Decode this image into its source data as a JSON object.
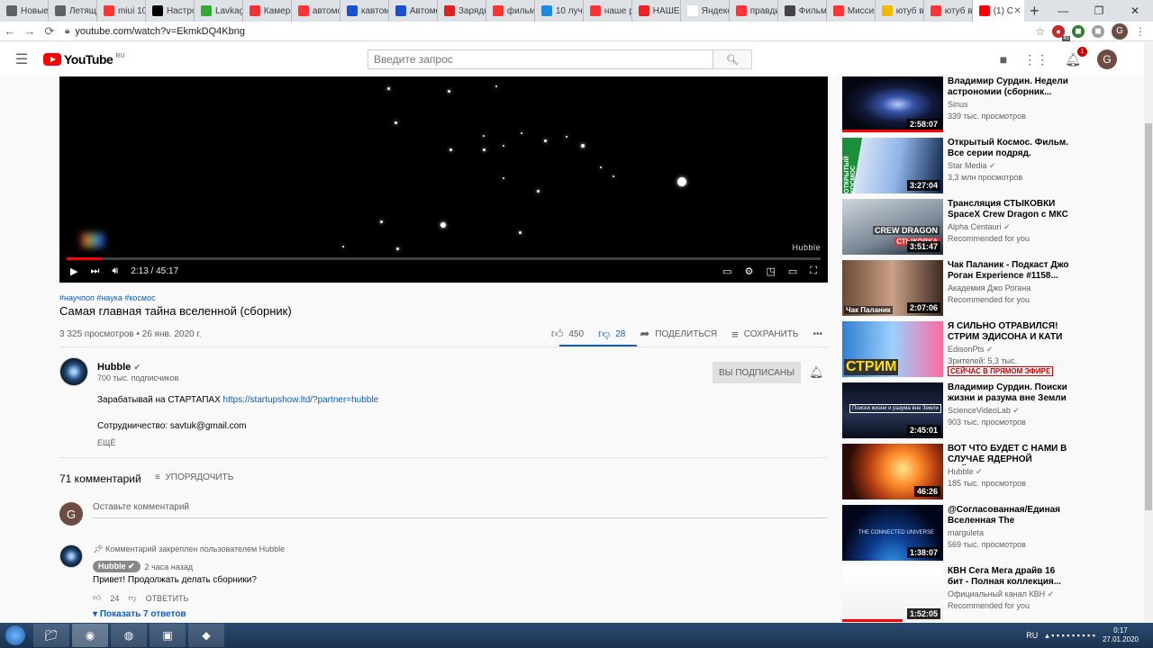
{
  "browser": {
    "tabs": [
      {
        "title": "Новые",
        "icon": "globe-icon",
        "color": "#5f6368"
      },
      {
        "title": "Летящ",
        "icon": "globe-icon",
        "color": "#5f6368"
      },
      {
        "title": "miui 10",
        "icon": "yandex-icon",
        "color": "#f33"
      },
      {
        "title": "Настро",
        "icon": "t2-icon",
        "color": "#000"
      },
      {
        "title": "Lavkag",
        "icon": "leaf-icon",
        "color": "#3a3"
      },
      {
        "title": "Камера",
        "icon": "l-icon",
        "color": "#e33"
      },
      {
        "title": "автомо",
        "icon": "yandex-icon",
        "color": "#f33"
      },
      {
        "title": "кавтом",
        "icon": "cart-icon",
        "color": "#1a4fd0"
      },
      {
        "title": "Автомо",
        "icon": "cart-icon",
        "color": "#1a4fd0"
      },
      {
        "title": "Зарядн",
        "icon": "circle-icon",
        "color": "#d22"
      },
      {
        "title": "фильм",
        "icon": "yandex-icon",
        "color": "#f33"
      },
      {
        "title": "10 лучш",
        "icon": "f-icon",
        "color": "#1e88e5"
      },
      {
        "title": "наше р",
        "icon": "yandex-icon",
        "color": "#f33"
      },
      {
        "title": "НАШЕ",
        "icon": "n-icon",
        "color": "#e22"
      },
      {
        "title": "Яндекс",
        "icon": "blank-icon",
        "color": "#fff"
      },
      {
        "title": "правди",
        "icon": "yandex-icon",
        "color": "#f33"
      },
      {
        "title": "Фильм",
        "icon": "heart-icon",
        "color": "#444"
      },
      {
        "title": "Миссия",
        "icon": "yandex-icon",
        "color": "#f33"
      },
      {
        "title": "ютуб в",
        "icon": "play-icon",
        "color": "#f5b800"
      },
      {
        "title": "ютуб в",
        "icon": "yandex-icon",
        "color": "#f33"
      },
      {
        "title": "(1) С",
        "icon": "youtube-icon",
        "color": "#f00"
      }
    ],
    "url": "youtube.com/watch?v=EkmkDQ4Kbng",
    "ext_badge": "45"
  },
  "header": {
    "logo_text": "YouTube",
    "logo_region": "RU",
    "search_placeholder": "Введите запрос",
    "notif_count": "1",
    "avatar_letter": "G"
  },
  "player": {
    "watermark": "Hubble",
    "time": "2:13 / 45:17",
    "progress_fraction": 0.047
  },
  "video": {
    "hashtags": "#научпоп #наука #космос",
    "title": "Самая главная тайна вселенной (сборник)",
    "views_date": "3 325 просмотров • 26 янв. 2020 г.",
    "likes": "450",
    "dislikes": "28",
    "share": "ПОДЕЛИТЬСЯ",
    "save": "СОХРАНИТЬ",
    "more": "•••"
  },
  "owner": {
    "name": "Hubble",
    "subscribers": "700 тыс. подписчиков",
    "subscribed_label": "ВЫ ПОДПИСАНЫ"
  },
  "description": {
    "line1_text": "Зарабатывай на СТАРТАПАХ",
    "line1_link": "https://startupshow.ltd/?partner=hubble",
    "line2": "Сотрудничество: savtuk@gmail.com",
    "more": "ЕЩЁ"
  },
  "comments": {
    "count": "71 комментарий",
    "sort_label": "УПОРЯДОЧИТЬ",
    "placeholder": "Оставьте комментарий",
    "user_letter": "G",
    "pinned_label": "Комментарий закреплен пользователем Hubble",
    "top": {
      "author": "Hubble",
      "time": "2 часа назад",
      "text": "Привет! Продолжать делать сборники?",
      "likes": "24",
      "reply": "ОТВЕТИТЬ",
      "show_replies": "Показать 7 ответов"
    }
  },
  "related": [
    {
      "title": "Владимир Сурдин. Недели астрономии (сборник...",
      "channel": "Sinus",
      "views": "339 тыс. просмотров",
      "duration": "2:58:07",
      "verified": false,
      "live": "",
      "watched": 1.0
    },
    {
      "title": "Открытый Космос. Фильм. Все серии подряд. StarMedia",
      "channel": "Star Media",
      "views": "3,3 млн просмотров",
      "duration": "3:27:04",
      "verified": true,
      "live": "",
      "watched": 0
    },
    {
      "title": "Трансляция СТЫКОВКИ SpaceX Crew Dragon с МКС",
      "channel": "Alpha Centauri",
      "views": "Recommended for you",
      "duration": "3:51:47",
      "verified": true,
      "live": "",
      "watched": 0
    },
    {
      "title": "Чак Паланик - Подкаст Джо Роган Experience #1158...",
      "channel": "Академия Джо Рогана",
      "views": "Recommended for you",
      "duration": "2:07:06",
      "verified": false,
      "live": "",
      "watched": 0
    },
    {
      "title": "Я СИЛЬНО ОТРАВИЛСЯ! СТРИМ ЭДИСОНА И КАТИ",
      "channel": "EdisonPts",
      "views": "Зрителей: 5,3 тыс.",
      "duration": "",
      "verified": true,
      "live": "СЕЙЧАС В ПРЯМОМ ЭФИРЕ",
      "watched": 0
    },
    {
      "title": "Владимир Сурдин. Поиски жизни и разума вне Земли",
      "channel": "ScienceVideoLab",
      "views": "903 тыс. просмотров",
      "duration": "2:45:01",
      "verified": true,
      "live": "",
      "watched": 0
    },
    {
      "title": "ВОТ ЧТО БУДЕТ С НАМИ В СЛУЧАЕ ЯДЕРНОЙ ВОЙНЫ...",
      "channel": "Hubble",
      "views": "185 тыс. просмотров",
      "duration": "46:26",
      "verified": true,
      "live": "",
      "watched": 0
    },
    {
      "title": "@Согласованная/Единая Вселенная The Connected...",
      "channel": "marguleta",
      "views": "569 тыс. просмотров",
      "duration": "1:38:07",
      "verified": false,
      "live": "",
      "watched": 0
    },
    {
      "title": "КВН Сега Мега драйв 16 бит - Полная коллекция...",
      "channel": "Официальный канал КВН",
      "views": "Recommended for you",
      "duration": "1:52:05",
      "verified": true,
      "live": "",
      "watched": 0.6
    }
  ],
  "thumb_text": {
    "crew": "CREW DRAGON",
    "dock": "СТЫКОВКА",
    "stream": "СТРИМ",
    "open_space": "ОТКРЫТЫЙ КОСМОС",
    "universe": "THE CONNECTED UNIVERSE",
    "palahniuk": "Чак Паланик",
    "surdin": "Поиски жизни и разума вне Земли"
  },
  "taskbar": {
    "lang": "RU",
    "time": "0:17",
    "date": "27.01.2020"
  }
}
